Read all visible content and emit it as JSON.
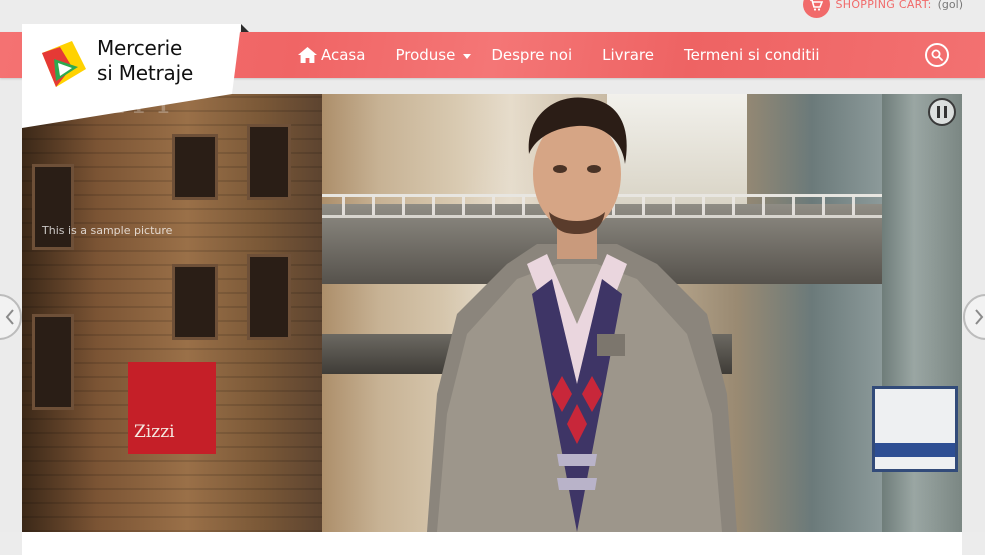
{
  "header": {
    "cart_label": "SHOPPING CART:",
    "cart_status": "(gol)"
  },
  "logo": {
    "line1": "Mercerie",
    "line2": "si Metraje",
    "colors": [
      "#e53935",
      "#2fa84f",
      "#ffd200"
    ]
  },
  "nav": {
    "items": [
      {
        "label": "Acasa",
        "icon": "home-icon"
      },
      {
        "label": "Produse",
        "has_dropdown": true
      },
      {
        "label": "Despre noi"
      },
      {
        "label": "Livrare"
      },
      {
        "label": "Termeni si conditii"
      }
    ],
    "search_icon": "search-icon",
    "accent": "#f16a6a"
  },
  "slider": {
    "caption_title": "CITY",
    "caption_text": "This is a sample picture",
    "storefront_sign": "Zizzi",
    "pause_icon": "pause-icon",
    "prev_icon": "chevron-left-icon",
    "next_icon": "chevron-right-icon"
  }
}
